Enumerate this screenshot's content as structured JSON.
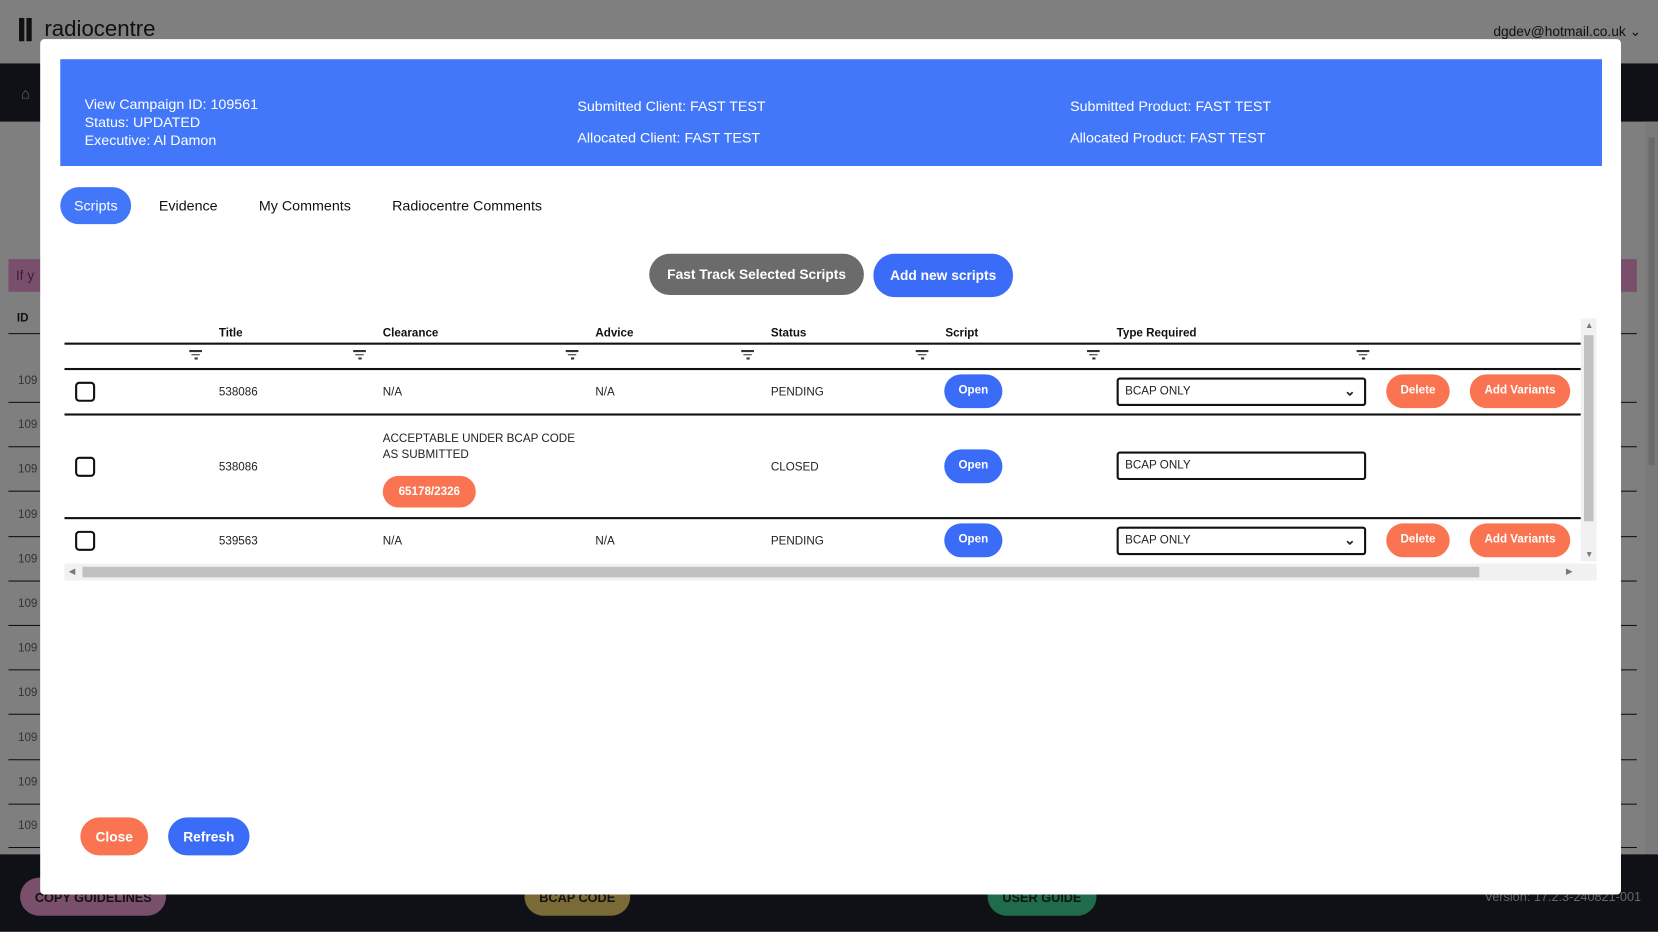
{
  "app": {
    "logo_text": "radiocentre",
    "user_email": "dgdev@hotmail.co.uk",
    "banner_text": "If y",
    "bg_id_header": "ID",
    "bg_ids": [
      "109",
      "109",
      "109",
      "109",
      "109",
      "109",
      "109",
      "109",
      "109",
      "109",
      "109"
    ],
    "footer": {
      "copy_guidelines": "COPY GUIDELINES",
      "bcap_code": "BCAP CODE",
      "user_guide": "USER GUIDE",
      "version": "Version: 17.2.3-240821-001"
    }
  },
  "modal": {
    "header": {
      "campaign_id": "View Campaign ID: 109561",
      "status": "Status: UPDATED",
      "executive": "Executive: Al Damon",
      "submitted_client": "Submitted Client: FAST TEST",
      "allocated_client": "Allocated Client: FAST TEST",
      "submitted_product": "Submitted Product: FAST TEST",
      "allocated_product": "Allocated Product: FAST TEST"
    },
    "tabs": [
      {
        "label": "Scripts",
        "active": true
      },
      {
        "label": "Evidence"
      },
      {
        "label": "My Comments"
      },
      {
        "label": "Radiocentre Comments"
      }
    ],
    "fast_track_label": "Fast Track Selected Scripts",
    "add_scripts_label": "Add new scripts",
    "columns": [
      "Title",
      "Clearance",
      "Advice",
      "Status",
      "Script",
      "Type Required"
    ],
    "rows": [
      {
        "title": "538086",
        "clearance": "N/A",
        "advice": "N/A",
        "status": "PENDING",
        "script": "Open",
        "type": "BCAP ONLY",
        "delete": "Delete",
        "variants": "Add Variants"
      },
      {
        "title": "538086",
        "clearance": "ACCEPTABLE UNDER BCAP CODE",
        "clearance2": "AS SUBMITTED",
        "badge": "65178/2326",
        "advice": "",
        "status": "CLOSED",
        "script": "Open",
        "type": "BCAP ONLY"
      },
      {
        "title": "539563",
        "clearance": "N/A",
        "advice": "N/A",
        "status": "PENDING",
        "script": "Open",
        "type": "BCAP ONLY",
        "delete": "Delete",
        "variants": "Add Variants"
      }
    ],
    "close_label": "Close",
    "refresh_label": "Refresh"
  },
  "colors": {
    "primary": "#4277fa",
    "danger": "#fa7451",
    "grey_button": "#6b6b6b"
  }
}
